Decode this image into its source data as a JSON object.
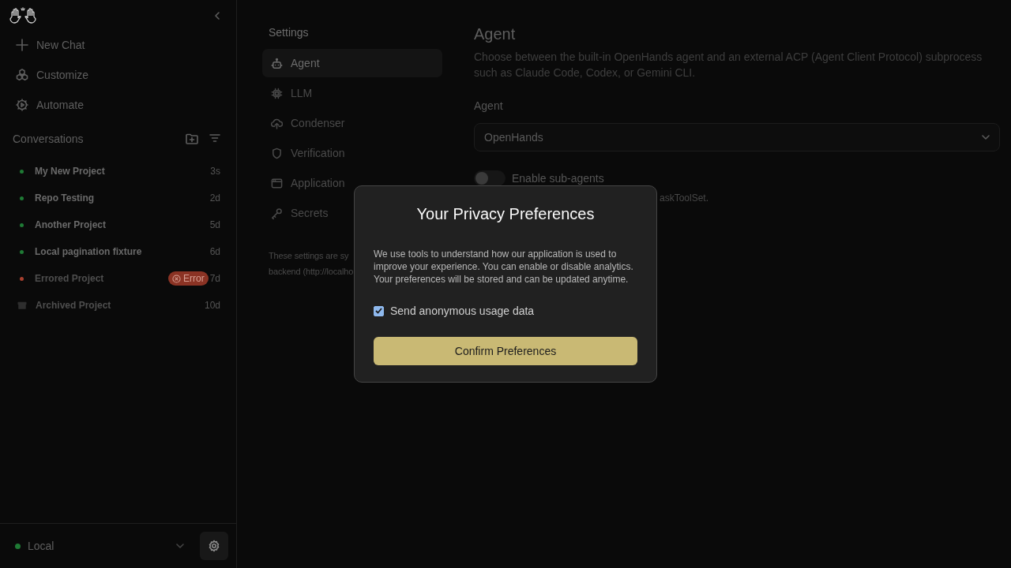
{
  "sidebar": {
    "nav": [
      {
        "label": "New Chat",
        "kind": "plus"
      },
      {
        "label": "Customize",
        "kind": "cubes"
      },
      {
        "label": "Automate",
        "kind": "automate"
      }
    ],
    "conversations": {
      "title": "Conversations",
      "items": [
        {
          "title": "My New Project",
          "age": "3s",
          "kind": "dot",
          "color": "#1f7a35"
        },
        {
          "title": "Repo Testing",
          "age": "2d",
          "kind": "dot",
          "color": "#1f7a35"
        },
        {
          "title": "Another Project",
          "age": "5d",
          "kind": "dot",
          "color": "#1f7a35"
        },
        {
          "title": "Local pagination fixture",
          "age": "6d",
          "kind": "dot",
          "color": "#1f7a35"
        },
        {
          "title": "Errored Project",
          "age": "7d",
          "kind": "dot",
          "color": "#a8402f",
          "badge": "Error"
        },
        {
          "title": "Archived Project",
          "age": "10d",
          "kind": "archived"
        }
      ]
    },
    "footer": {
      "label": "Local",
      "color": "#1f7a35"
    }
  },
  "settings": {
    "title": "Settings",
    "items": [
      {
        "label": "Agent",
        "kind": "robot",
        "selected": true
      },
      {
        "label": "LLM",
        "kind": "chip",
        "selected": false
      },
      {
        "label": "Condenser",
        "kind": "cloud",
        "selected": false
      },
      {
        "label": "Verification",
        "kind": "shield",
        "selected": false
      },
      {
        "label": "Application",
        "kind": "window",
        "selected": false
      },
      {
        "label": "Secrets",
        "kind": "key",
        "selected": false
      }
    ],
    "note_lines": [
      "These settings are sy",
      "backend (http://localho"
    ]
  },
  "agent": {
    "title": "Agent",
    "description": "Choose between the built-in OpenHands agent and an external ACP (Agent Client Protocol) subprocess such as Claude Code, Codex, or Gemini CLI.",
    "field_label": "Agent",
    "select_value": "OpenHands",
    "toggle": {
      "label": "Enable sub-agents",
      "on": false
    },
    "toggle_hint": "askToolSet."
  },
  "modal": {
    "title": "Your Privacy Preferences",
    "body": "We use tools to understand how our application is used to improve your experience. You can enable or disable analytics. Your preferences will be stored and can be updated anytime.",
    "checkbox": {
      "label": "Send anonymous usage data",
      "checked": true
    },
    "button": "Confirm Preferences"
  }
}
